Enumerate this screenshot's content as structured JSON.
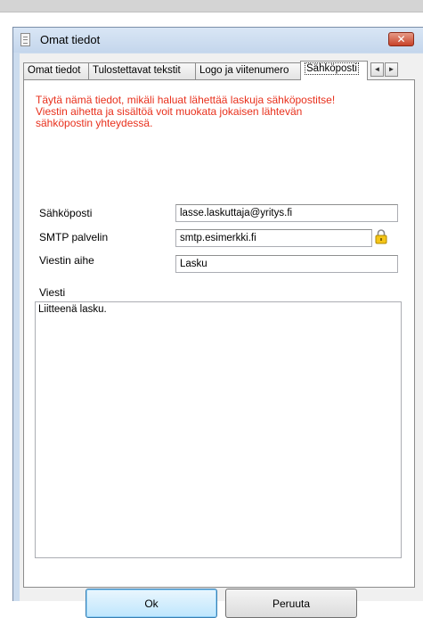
{
  "window": {
    "title": "Omat tiedot",
    "close_label": "✕"
  },
  "tabs": [
    {
      "label": "Omat tiedot",
      "active": false
    },
    {
      "label": "Tulostettavat tekstit",
      "active": false
    },
    {
      "label": "Logo ja viitenumero",
      "active": false
    },
    {
      "label": "Sähköposti",
      "active": true
    }
  ],
  "tab_scroll": {
    "left": "◄",
    "right": "►"
  },
  "notice": "Täytä nämä tiedot, mikäli haluat lähettää laskuja sähköpostitse!\nViestin aihetta ja sisältöä voit muokata jokaisen lähtevän\nsähköpostin yhteydessä.",
  "form": {
    "email_label": "Sähköposti",
    "email_value": "lasse.laskuttaja@yritys.fi",
    "smtp_label": "SMTP palvelin",
    "smtp_value": "smtp.esimerkki.fi",
    "subject_label": "Viestin aihe",
    "subject_value": "Lasku",
    "message_label": "Viesti",
    "message_value": "Liitteenä lasku."
  },
  "buttons": {
    "ok_label": "Ok",
    "cancel_label": "Peruuta"
  },
  "colors": {
    "notice_text": "#e8301c",
    "title_bar": "#c4d6ec",
    "close_button": "#c84229",
    "lock_icon": "#f5c518"
  },
  "icons": {
    "app": "form-icon",
    "lock": "lock-icon"
  }
}
